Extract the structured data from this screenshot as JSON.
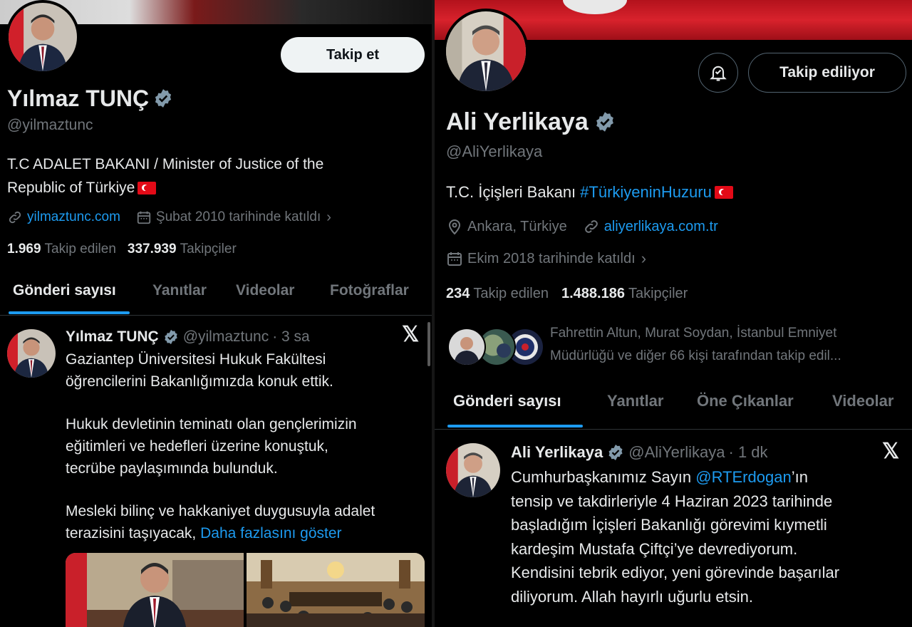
{
  "left": {
    "follow_button": "Takip et",
    "name": "Yılmaz TUNÇ",
    "handle": "@yilmaztunc",
    "bio_line1": "T.C ADALET BAKANI / Minister of Justice of the",
    "bio_line2": "Republic of Türkiye",
    "website": "yilmaztunc.com",
    "joined": "Şubat 2010 tarihinde katıldı",
    "following_count": "1.969",
    "following_label": "Takip edilen",
    "followers_count": "337.939",
    "followers_label": "Takipçiler",
    "tabs": [
      "Gönderi sayısı",
      "Yanıtlar",
      "Videolar",
      "Fotoğraflar"
    ],
    "tweet": {
      "name": "Yılmaz TUNÇ",
      "handle": "@yilmaztunc",
      "time": "· 3 sa",
      "line1": "Gaziantep Üniversitesi Hukuk Fakültesi",
      "line2": "öğrencilerini Bakanlığımızda konuk ettik.",
      "line3": "Hukuk devletinin teminatı olan gençlerimizin",
      "line4": "eğitimleri ve hedefleri üzerine konuştuk,",
      "line5": "tecrübe paylaşımında bulunduk.",
      "line6": "Mesleki bilinç ve hakkaniyet duygusuyla adalet",
      "line7": "terazisini taşıyacak,",
      "show_more": "Daha fazlasını göster"
    }
  },
  "right": {
    "following_button": "Takip ediliyor",
    "name": "Ali Yerlikaya",
    "handle": "@AliYerlikaya",
    "bio_text": "T.C. İçişleri Bakanı",
    "bio_hashtag": "#TürkiyeninHuzuru",
    "location": "Ankara, Türkiye",
    "website": "aliyerlikaya.com.tr",
    "joined": "Ekim 2018 tarihinde katıldı",
    "following_count": "234",
    "following_label": "Takip edilen",
    "followers_count": "1.488.186",
    "followers_label": "Takipçiler",
    "followed_by_line1": "Fahrettin Altun, Murat Soydan, İstanbul Emniyet",
    "followed_by_line2": "Müdürlüğü ve diğer 66 kişi tarafından takip edil...",
    "tabs": [
      "Gönderi sayısı",
      "Yanıtlar",
      "Öne Çıkanlar",
      "Videolar"
    ],
    "tweet": {
      "name": "Ali Yerlikaya",
      "handle": "@AliYerlikaya",
      "time": "· 1 dk",
      "line1_pre": "Cumhurbaşkanımız Sayın",
      "mention": "@RTErdogan",
      "line1_post": "’ın",
      "line2": "tensip ve takdirleriyle 4 Haziran 2023 tarihinde",
      "line3": "başladığım İçişleri Bakanlığı görevimi kıymetli",
      "line4": "kardeşim Mustafa Çiftçi’ye devrediyorum.",
      "line5": "Kendisini tebrik ediyor, yeni görevinde başarılar",
      "line6": "diliyorum. Allah hayırlı uğurlu etsin."
    }
  },
  "colors": {
    "accent": "#1d9bf0",
    "muted": "#71767b",
    "verified": "#829aab",
    "flag": "#e30a17"
  }
}
